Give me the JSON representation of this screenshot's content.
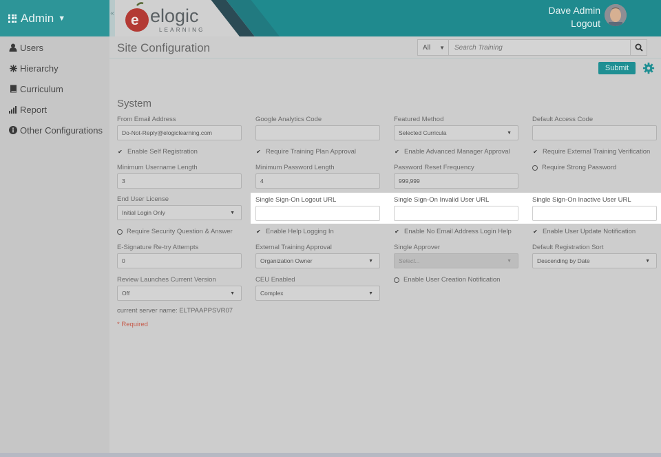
{
  "header": {
    "admin_label": "Admin",
    "logo_word": "elogic",
    "logo_sub": "LEARNING",
    "user_name": "Dave Admin",
    "logout_label": "Logout"
  },
  "sidebar": {
    "items": [
      {
        "label": "Users",
        "icon": "user-icon"
      },
      {
        "label": "Hierarchy",
        "icon": "hierarchy-icon"
      },
      {
        "label": "Curriculum",
        "icon": "book-icon"
      },
      {
        "label": "Report",
        "icon": "bar-chart-icon"
      },
      {
        "label": "Other Configurations",
        "icon": "info-icon"
      }
    ]
  },
  "main": {
    "page_title": "Site Configuration",
    "search": {
      "filter_value": "All",
      "placeholder": "Search Training"
    },
    "submit_label": "Submit",
    "section_title": "System",
    "fields": {
      "from_email": {
        "label": "From Email Address",
        "value": "Do-Not-Reply@elogiclearning.com"
      },
      "google_analytics": {
        "label": "Google Analytics Code",
        "value": ""
      },
      "featured_method": {
        "label": "Featured Method",
        "value": "Selected Curricula"
      },
      "default_access_code": {
        "label": "Default Access Code",
        "value": ""
      },
      "min_username": {
        "label": "Minimum Username Length",
        "value": "3"
      },
      "min_password": {
        "label": "Minimum Password Length",
        "value": "4"
      },
      "password_reset": {
        "label": "Password Reset Frequency",
        "value": "999,999"
      },
      "end_user_license": {
        "label": "End User License",
        "value": "Initial Login Only"
      },
      "sso_logout": {
        "label": "Single Sign-On Logout URL",
        "value": ""
      },
      "sso_invalid": {
        "label": "Single Sign-On Invalid User URL",
        "value": ""
      },
      "sso_inactive": {
        "label": "Single Sign-On Inactive User URL",
        "value": ""
      },
      "esig_retry": {
        "label": "E-Signature Re-try Attempts",
        "value": "0"
      },
      "external_training_approval": {
        "label": "External Training Approval",
        "value": "Organization Owner"
      },
      "single_approver": {
        "label": "Single Approver",
        "value": "Select..."
      },
      "default_registration_sort": {
        "label": "Default Registration Sort",
        "value": "Descending by Date"
      },
      "review_launches": {
        "label": "Review Launches Current Version",
        "value": "Off"
      },
      "ceu_enabled": {
        "label": "CEU Enabled",
        "value": "Complex"
      }
    },
    "checks": {
      "self_registration": {
        "label": "Enable Self Registration",
        "checked": true
      },
      "training_plan_approval": {
        "label": "Require Training Plan Approval",
        "checked": true
      },
      "advanced_manager_approval": {
        "label": "Enable Advanced Manager Approval",
        "checked": true
      },
      "external_training_verification": {
        "label": "Require External Training Verification",
        "checked": true
      },
      "strong_password": {
        "label": "Require Strong Password",
        "checked": false
      },
      "security_question": {
        "label": "Require Security Question & Answer",
        "checked": false
      },
      "help_logging": {
        "label": "Enable Help Logging In",
        "checked": true
      },
      "no_email_login_help": {
        "label": "Enable No Email Address Login Help",
        "checked": true
      },
      "user_update_notification": {
        "label": "Enable User Update Notification",
        "checked": true
      },
      "user_creation_notification": {
        "label": "Enable User Creation Notification",
        "checked": false
      }
    },
    "server_name": "current server name: ELTPAAPPSVR07",
    "required_note": "* Required"
  },
  "colors": {
    "header_teal": "#1f8a8e",
    "submit_teal": "#1f8f93",
    "required_red": "#c55a4a"
  }
}
